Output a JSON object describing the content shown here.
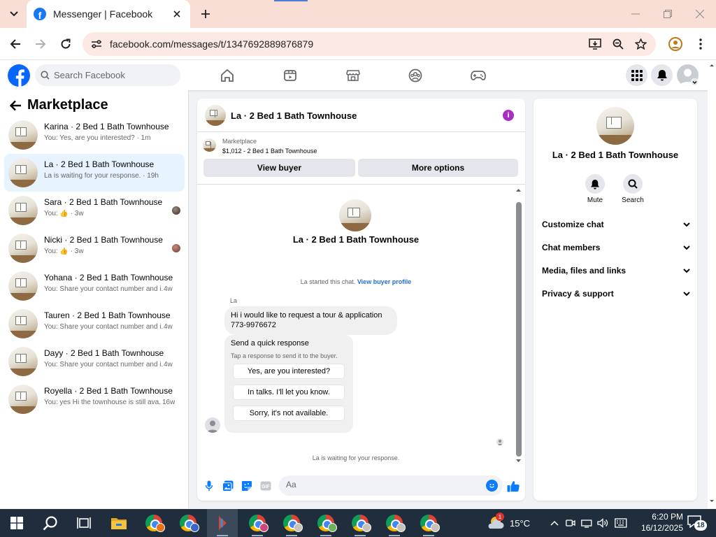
{
  "browser": {
    "tab_title": "Messenger | Facebook",
    "url": "facebook.com/messages/t/1347692889876879"
  },
  "fb": {
    "search_placeholder": "Search Facebook",
    "brand_color": "#1877f2"
  },
  "sidebar": {
    "title": "Marketplace",
    "conversations": [
      {
        "name": "Karina · 2 Bed 1 Bath Townhouse",
        "preview": "You: Yes, are you interested? · 1m"
      },
      {
        "name": "La · 2 Bed 1 Bath Townhouse",
        "preview": "La is waiting for your response. · 19h",
        "active": true
      },
      {
        "name": "Sara · 2 Bed 1 Bath Townhouse",
        "preview": "You: 👍 · 3w"
      },
      {
        "name": "Nicki · 2 Bed 1 Bath Townhouse",
        "preview": "You: 👍 · 3w"
      },
      {
        "name": "Yohana · 2 Bed 1 Bath Townhouse",
        "preview": "You: Share your contact number and i...",
        "time": "4w"
      },
      {
        "name": "Tauren · 2 Bed 1 Bath Townhouse",
        "preview": "You: Share your contact number and i...",
        "time": "4w"
      },
      {
        "name": "Dayy · 2 Bed 1 Bath Townhouse",
        "preview": "You: Share your contact number and i...",
        "time": "4w"
      },
      {
        "name": "Royella · 2 Bed 1 Bath Townhouse",
        "preview": "You: yes Hi the townhouse is still ava...",
        "time": "16w"
      }
    ]
  },
  "chat": {
    "header_name": "La · 2 Bed 1 Bath Townhouse",
    "marketplace_label": "Marketplace",
    "listing": "$1,012 - 2 Bed 1 Bath Townhouse",
    "view_buyer": "View buyer",
    "more_options": "More options",
    "profile_name": "La · 2 Bed 1 Bath Townhouse",
    "started_text": "La started this chat.",
    "view_profile": "View buyer profile",
    "sender": "La",
    "message_line1": "Hi i would like to request a tour & application",
    "message_line2": "773-9976672",
    "quick_title": "Send a quick response",
    "quick_sub": "Tap a response to send it to the buyer.",
    "quick_options": [
      "Yes, are you interested?",
      "In talks. I'll let you know.",
      "Sorry, it's not available."
    ],
    "waiting": "La is waiting for your response.",
    "composer_placeholder": "Aa"
  },
  "details": {
    "name": "La · 2 Bed 1 Bath Townhouse",
    "mute": "Mute",
    "search": "Search",
    "sections": [
      "Customize chat",
      "Chat members",
      "Media, files and links",
      "Privacy & support"
    ]
  },
  "taskbar": {
    "temperature": "15°C",
    "time": "6:20 PM",
    "date": "16/12/2025",
    "notifications": "18",
    "weather_badge": "1"
  }
}
